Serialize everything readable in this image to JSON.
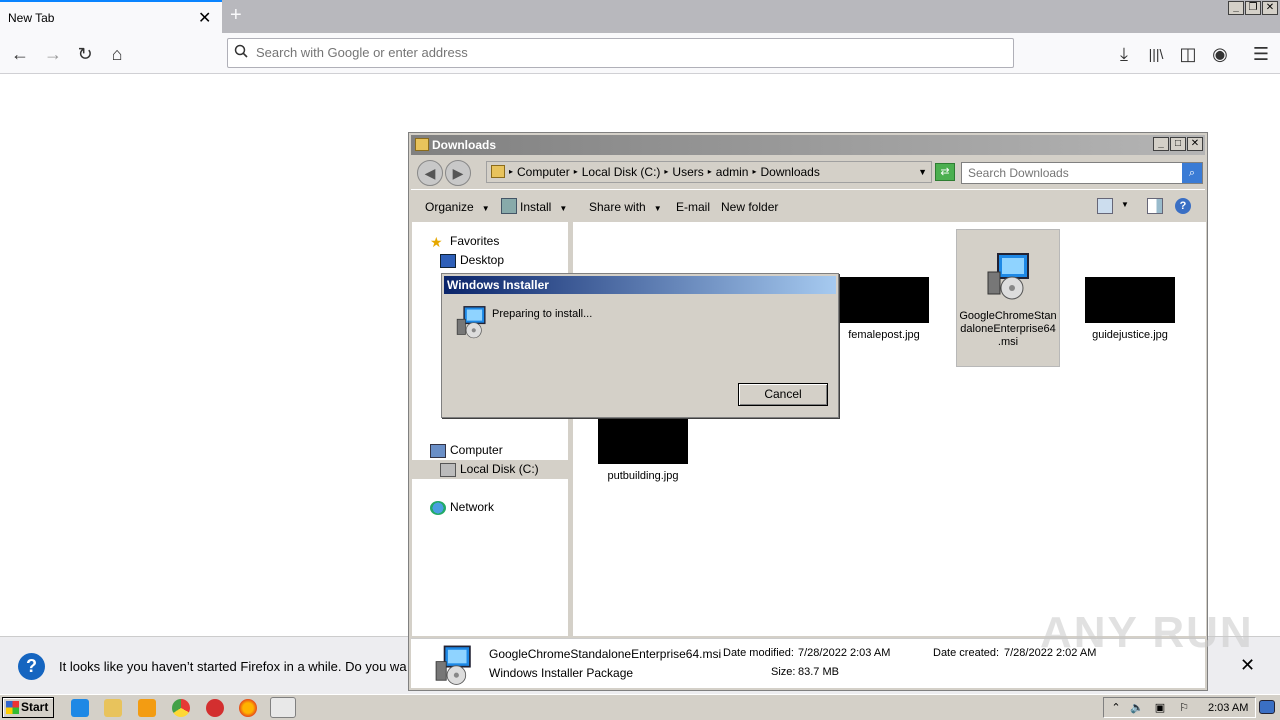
{
  "browser": {
    "tab_title": "New Tab",
    "url_placeholder": "Search with Google or enter address"
  },
  "notification": {
    "message": "It looks like you haven’t started Firefox in a while. Do you wa"
  },
  "explorer": {
    "title": "Downloads",
    "breadcrumbs": [
      "Computer",
      "Local Disk (C:)",
      "Users",
      "admin",
      "Downloads"
    ],
    "search_placeholder": "Search Downloads",
    "toolbar": {
      "organize": "Organize",
      "install": "Install",
      "share_with": "Share with",
      "email": "E-mail",
      "new_folder": "New folder"
    },
    "nav": {
      "favorites": "Favorites",
      "desktop": "Desktop",
      "computer": "Computer",
      "local_disk": "Local Disk (C:)",
      "network": "Network"
    },
    "files": [
      {
        "name": "femalepost.jpg"
      },
      {
        "name": "GoogleChromeStandaloneEnterprise64.msi",
        "display": "GoogleChromeStan daloneEnterprise64 .msi"
      },
      {
        "name": "guidejustice.jpg"
      },
      {
        "name": "putbuilding.jpg"
      }
    ],
    "details": {
      "filename": "GoogleChromeStandaloneEnterprise64.msi",
      "type": "Windows Installer Package",
      "modified_label": "Date modified:",
      "modified": "7/28/2022 2:03 AM",
      "size_label": "Size:",
      "size": "83.7 MB",
      "created_label": "Date created:",
      "created": "7/28/2022 2:02 AM"
    }
  },
  "installer": {
    "title": "Windows Installer",
    "message": "Preparing to install...",
    "cancel": "Cancel"
  },
  "taskbar": {
    "start": "Start",
    "clock": "2:03 AM"
  },
  "watermark": "ANY RUN"
}
